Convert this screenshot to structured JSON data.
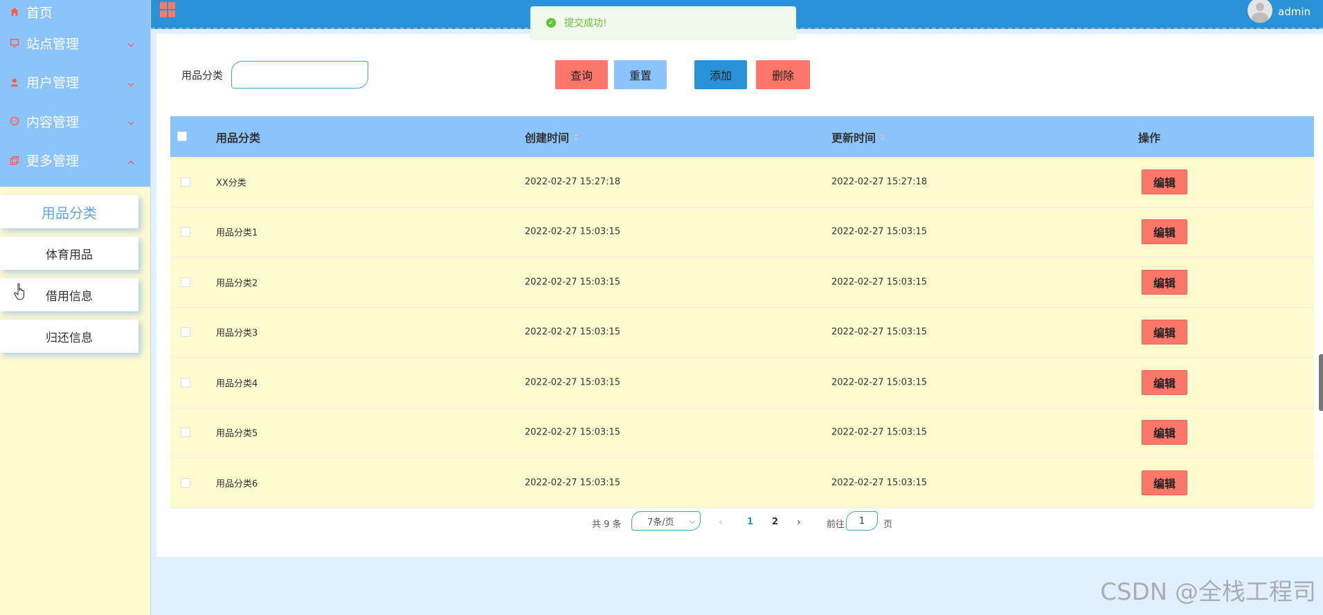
{
  "sidebar": {
    "items": [
      {
        "label": "首页",
        "icon": "home-icon"
      },
      {
        "label": "站点管理",
        "icon": "monitor-icon"
      },
      {
        "label": "用户管理",
        "icon": "user-icon"
      },
      {
        "label": "内容管理",
        "icon": "chat-icon"
      },
      {
        "label": "更多管理",
        "icon": "copy-icon"
      }
    ],
    "submenu": [
      "用品分类",
      "体育用品",
      "借用信息",
      "归还信息"
    ]
  },
  "header": {
    "username": "admin"
  },
  "toast": {
    "message": "提交成功!"
  },
  "search": {
    "label": "用品分类",
    "value": "",
    "placeholder": ""
  },
  "buttons": {
    "query": "查询",
    "reset": "重置",
    "add": "添加",
    "delete": "删除"
  },
  "table": {
    "columns": [
      "用品分类",
      "创建时间",
      "更新时间",
      "操作"
    ],
    "edit_label": "编辑",
    "rows": [
      {
        "category": "XX分类",
        "created": "2022-02-27 15:27:18",
        "updated": "2022-02-27 15:27:18"
      },
      {
        "category": "用品分类1",
        "created": "2022-02-27 15:03:15",
        "updated": "2022-02-27 15:03:15"
      },
      {
        "category": "用品分类2",
        "created": "2022-02-27 15:03:15",
        "updated": "2022-02-27 15:03:15"
      },
      {
        "category": "用品分类3",
        "created": "2022-02-27 15:03:15",
        "updated": "2022-02-27 15:03:15"
      },
      {
        "category": "用品分类4",
        "created": "2022-02-27 15:03:15",
        "updated": "2022-02-27 15:03:15"
      },
      {
        "category": "用品分类5",
        "created": "2022-02-27 15:03:15",
        "updated": "2022-02-27 15:03:15"
      },
      {
        "category": "用品分类6",
        "created": "2022-02-27 15:03:15",
        "updated": "2022-02-27 15:03:15"
      }
    ]
  },
  "pagination": {
    "total": "共 9 条",
    "page_size": "7条/页",
    "pages": [
      "1",
      "2"
    ],
    "current_page": "1",
    "goto_label": "前往",
    "goto_value": "1",
    "page_suffix": "页"
  },
  "watermark": "CSDN @全栈工程司",
  "colors": {
    "header_bg": "#2b92d7",
    "sidebar_menu_bg": "#8bc3fb",
    "sidebar_bg": "#fefad0",
    "row_bg": "#fefad0",
    "accent_red": "#ff776a",
    "success": "#67c23a"
  }
}
